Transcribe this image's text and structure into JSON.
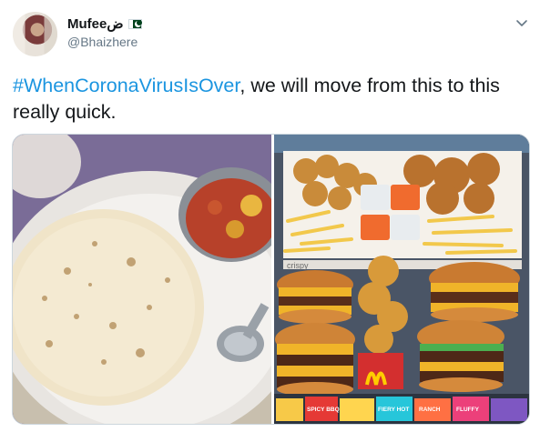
{
  "user": {
    "display_name": "Mufeeض",
    "handle": "@Bhaizhere",
    "avatar_icon": "profile-avatar",
    "flag_icon": "pakistan-flag-icon"
  },
  "tweet": {
    "hashtag": "#WhenCoronaVirusIsOver",
    "text": ", we will move from this to this really quick."
  },
  "media": {
    "left_image": "roti-and-curry-photo",
    "right_image": "fast-food-feast-photo",
    "packaging_texts": [
      "crispy",
      "SPICY BBQ",
      "FIERY HOT",
      "RANCH",
      "FLUFFY"
    ]
  },
  "colors": {
    "link": "#1b95e0",
    "text": "#14171a",
    "secondary": "#657786"
  }
}
